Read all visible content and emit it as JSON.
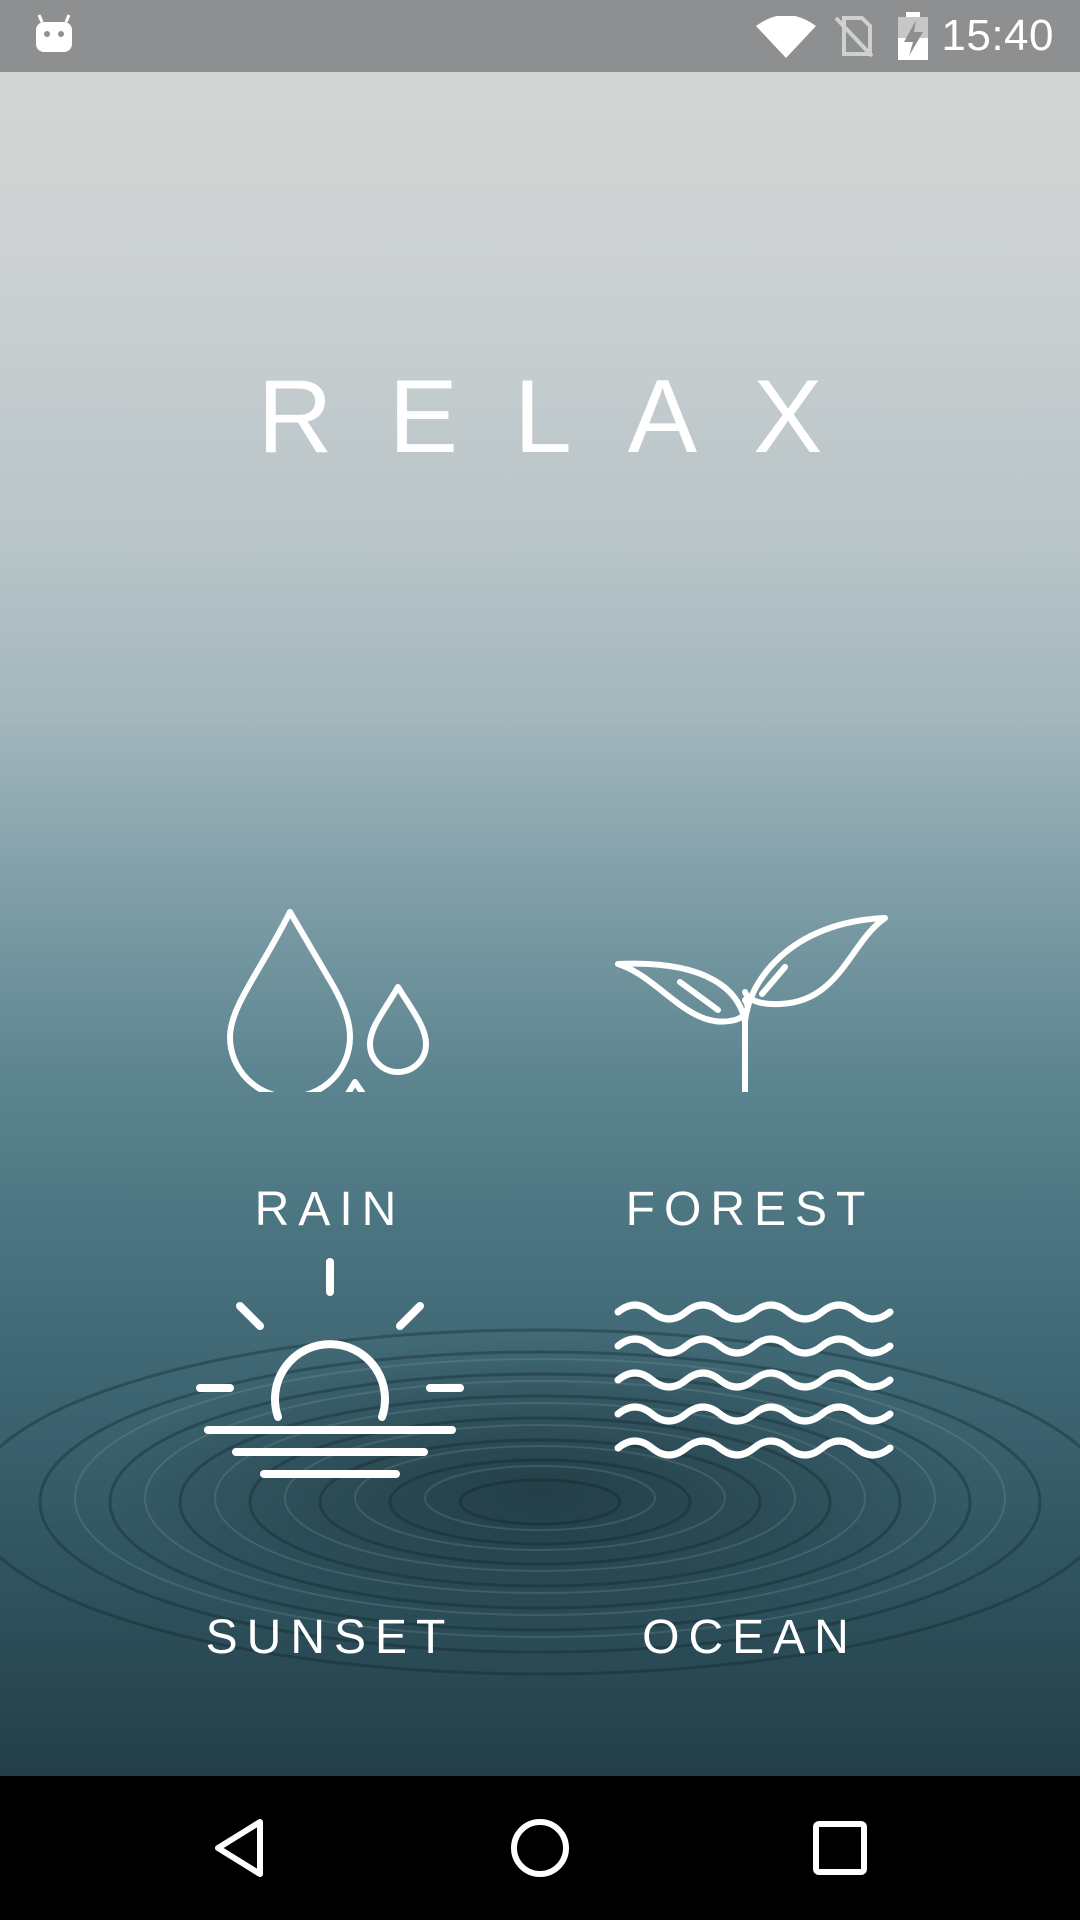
{
  "status_bar": {
    "time": "15:40",
    "icons": [
      "android-icon",
      "wifi-icon",
      "no-sim-icon",
      "battery-charging-icon"
    ]
  },
  "app": {
    "title": "RELAX"
  },
  "tiles": [
    {
      "label": "RAIN",
      "icon": "rain-drops-icon"
    },
    {
      "label": "FOREST",
      "icon": "sprout-icon"
    },
    {
      "label": "SUNSET",
      "icon": "sunset-icon"
    },
    {
      "label": "OCEAN",
      "icon": "waves-icon"
    }
  ],
  "nav_bar": {
    "icons": [
      "back-icon",
      "home-icon",
      "recents-icon"
    ]
  },
  "colors": {
    "status_bar_bg": "#8e8f90",
    "nav_bar_bg": "#000000",
    "text": "#ffffff",
    "sky_top": "#d4d6d5",
    "water_bottom": "#233e46"
  }
}
